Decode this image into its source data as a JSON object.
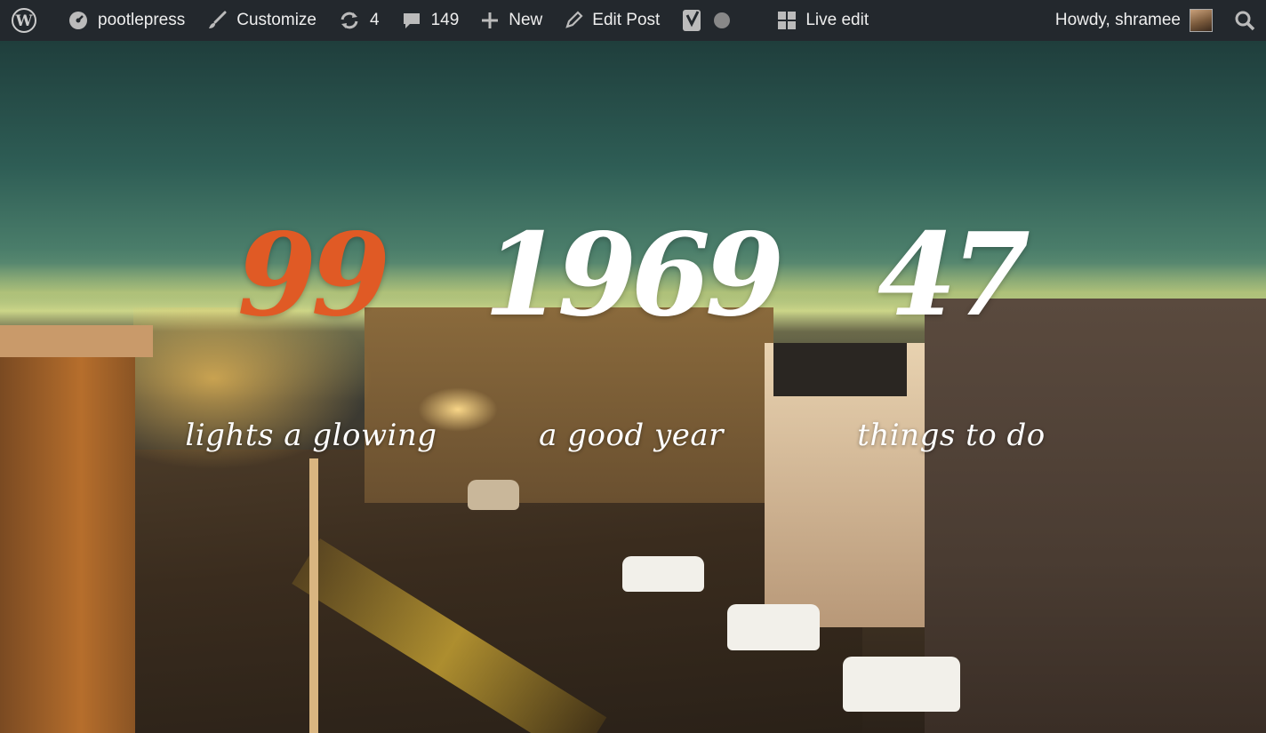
{
  "adminbar": {
    "site_name": "pootlepress",
    "customize": "Customize",
    "updates_count": "4",
    "comments_count": "149",
    "new": "New",
    "edit_post": "Edit Post",
    "live_edit": "Live edit",
    "howdy": "Howdy, shramee"
  },
  "counters": [
    {
      "number": "99",
      "label": "lights a glowing",
      "color": "#e05a25"
    },
    {
      "number": "1969",
      "label": "a good year",
      "color": "#ffffff"
    },
    {
      "number": "47",
      "label": "things to do",
      "color": "#ffffff"
    }
  ],
  "colors": {
    "adminbar_bg": "#23282d",
    "accent": "#e05a25"
  }
}
